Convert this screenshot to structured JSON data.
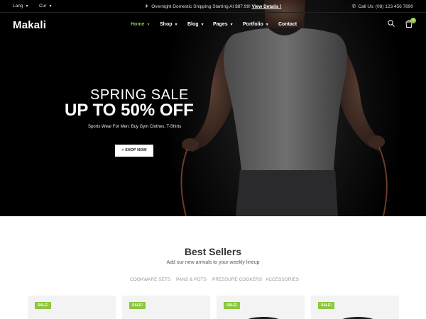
{
  "topbar": {
    "lang": "Lang",
    "cur": "Cur",
    "promo_text": "Overnight Domestic Shipping Starting At $87.99!",
    "promo_link": "View Details !",
    "phone": "Call Us: (08) 123 456 7890"
  },
  "header": {
    "logo": "Makali",
    "nav": [
      "Home",
      "Shop",
      "Blog",
      "Pages",
      "Portfolio",
      "Contact"
    ],
    "active_nav": "Home",
    "cart_count": "0"
  },
  "hero": {
    "subtitle": "SPRING SALE",
    "title": "UP TO 50% OFF",
    "description": "Sports Wear For Men: Buy Gym Clothes, T-Shirts",
    "button": "+ SHOP NOW"
  },
  "best_sellers": {
    "title": "Best Sellers",
    "subtitle": "Add our new arrivals to your weekly lineup",
    "filters": [
      "COOKWARE SETS",
      "PANS & POTS",
      "PRESSURE COOKERS",
      "ACCESSORIES"
    ],
    "badges": [
      "SALE!",
      "SALE!",
      "SALE!",
      "SALE!"
    ]
  },
  "colors": {
    "accent": "#8dc63f",
    "hero_bg": "#000000",
    "title_text": "#333333"
  },
  "icons": [
    "airplane-icon",
    "phone-icon",
    "search-icon",
    "cart-icon"
  ]
}
